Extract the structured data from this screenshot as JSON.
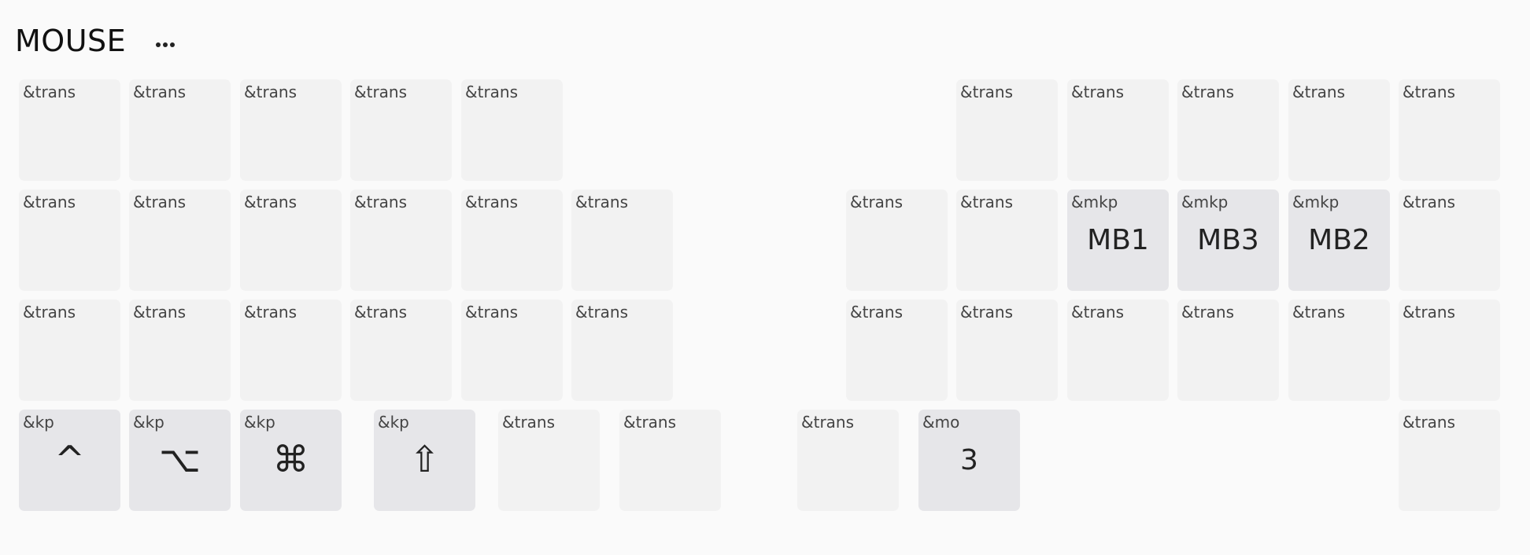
{
  "layer": {
    "title": "MOUSE"
  },
  "colors": {
    "background": "#fafafa",
    "key_trans": "#f2f2f2",
    "key_active": "#e6e6e9"
  },
  "keys": [
    {
      "binding": "&trans",
      "param": ""
    },
    {
      "binding": "&trans",
      "param": ""
    },
    {
      "binding": "&trans",
      "param": ""
    },
    {
      "binding": "&trans",
      "param": ""
    },
    {
      "binding": "&trans",
      "param": ""
    },
    {
      "binding": "&trans",
      "param": ""
    },
    {
      "binding": "&trans",
      "param": ""
    },
    {
      "binding": "&trans",
      "param": ""
    },
    {
      "binding": "&trans",
      "param": ""
    },
    {
      "binding": "&trans",
      "param": ""
    },
    {
      "binding": "&trans",
      "param": ""
    },
    {
      "binding": "&trans",
      "param": ""
    },
    {
      "binding": "&trans",
      "param": ""
    },
    {
      "binding": "&trans",
      "param": ""
    },
    {
      "binding": "&trans",
      "param": ""
    },
    {
      "binding": "&trans",
      "param": ""
    },
    {
      "binding": "&trans",
      "param": ""
    },
    {
      "binding": "&trans",
      "param": ""
    },
    {
      "binding": "&mkp",
      "param": "MB1"
    },
    {
      "binding": "&mkp",
      "param": "MB3"
    },
    {
      "binding": "&mkp",
      "param": "MB2"
    },
    {
      "binding": "&trans",
      "param": ""
    },
    {
      "binding": "&trans",
      "param": ""
    },
    {
      "binding": "&trans",
      "param": ""
    },
    {
      "binding": "&trans",
      "param": ""
    },
    {
      "binding": "&trans",
      "param": ""
    },
    {
      "binding": "&trans",
      "param": ""
    },
    {
      "binding": "&trans",
      "param": ""
    },
    {
      "binding": "&trans",
      "param": ""
    },
    {
      "binding": "&trans",
      "param": ""
    },
    {
      "binding": "&trans",
      "param": ""
    },
    {
      "binding": "&trans",
      "param": ""
    },
    {
      "binding": "&trans",
      "param": ""
    },
    {
      "binding": "&trans",
      "param": ""
    },
    {
      "binding": "&kp",
      "param": "^"
    },
    {
      "binding": "&kp",
      "param": "⌥"
    },
    {
      "binding": "&kp",
      "param": "⌘"
    },
    {
      "binding": "&kp",
      "param": "⇧"
    },
    {
      "binding": "&trans",
      "param": ""
    },
    {
      "binding": "&trans",
      "param": ""
    },
    {
      "binding": "&trans",
      "param": ""
    },
    {
      "binding": "&mo",
      "param": "3"
    },
    {
      "binding": "&trans",
      "param": ""
    }
  ]
}
